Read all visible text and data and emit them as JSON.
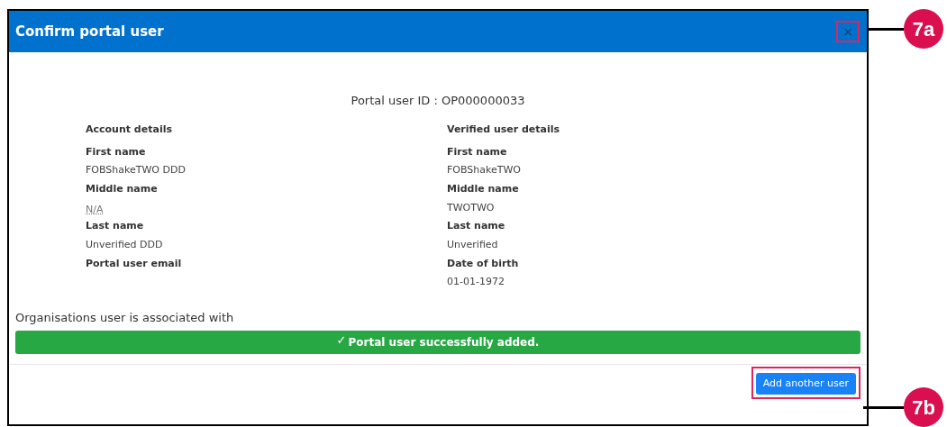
{
  "dialog": {
    "title": "Confirm portal user",
    "close": "×",
    "portal_user_id": "Portal user ID : OP000000033",
    "columns": [
      {
        "heading": "Account details",
        "items": [
          {
            "kind": "label",
            "text": "First name"
          },
          {
            "kind": "value",
            "text": "FOBShakeTWO DDD"
          },
          {
            "kind": "label",
            "text": "Middle name"
          },
          {
            "kind": "abbr",
            "text": "N/A"
          },
          {
            "kind": "label",
            "text": "Last name"
          },
          {
            "kind": "value",
            "text": "Unverified DDD"
          },
          {
            "kind": "label",
            "text": "Portal user email"
          }
        ]
      },
      {
        "heading": "Verified user details",
        "items": [
          {
            "kind": "label",
            "text": "First name"
          },
          {
            "kind": "value",
            "text": "FOBShakeTWO"
          },
          {
            "kind": "label",
            "text": "Middle name"
          },
          {
            "kind": "value",
            "text": "TWOTWO"
          },
          {
            "kind": "label",
            "text": "Last name"
          },
          {
            "kind": "value",
            "text": "Unverified"
          },
          {
            "kind": "label",
            "text": "Date of birth"
          },
          {
            "kind": "value",
            "text": "01-01-1972"
          }
        ]
      }
    ],
    "organisations_heading": "Organisations user is associated with",
    "alert": {
      "icon": "✓",
      "message": "Portal user successfully added."
    },
    "button": "Add another user"
  },
  "callouts": [
    {
      "label": "7a"
    },
    {
      "label": "7b"
    }
  ]
}
